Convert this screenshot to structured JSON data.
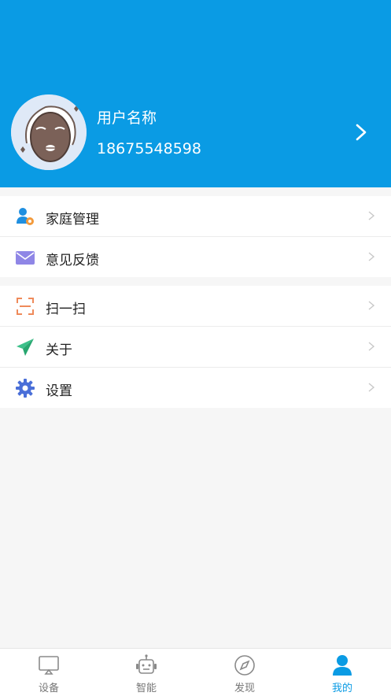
{
  "profile": {
    "name": "用户名称",
    "phone": "18675548598"
  },
  "menu_groups": [
    [
      {
        "label": "家庭管理",
        "icon": "family-user-icon"
      },
      {
        "label": "意见反馈",
        "icon": "envelope-icon"
      }
    ],
    [
      {
        "label": "扫一扫",
        "icon": "scan-icon"
      },
      {
        "label": "关于",
        "icon": "paper-plane-icon"
      },
      {
        "label": "设置",
        "icon": "gear-icon"
      }
    ]
  ],
  "tabs": [
    {
      "label": "设备",
      "icon": "device-icon",
      "active": false
    },
    {
      "label": "智能",
      "icon": "robot-icon",
      "active": false
    },
    {
      "label": "发现",
      "icon": "compass-icon",
      "active": false
    },
    {
      "label": "我的",
      "icon": "user-icon",
      "active": true
    }
  ],
  "colors": {
    "header": "#0a9be4",
    "active_tab": "#0a9be4",
    "inactive_tab": "#777777",
    "background": "#f6f6f6"
  }
}
